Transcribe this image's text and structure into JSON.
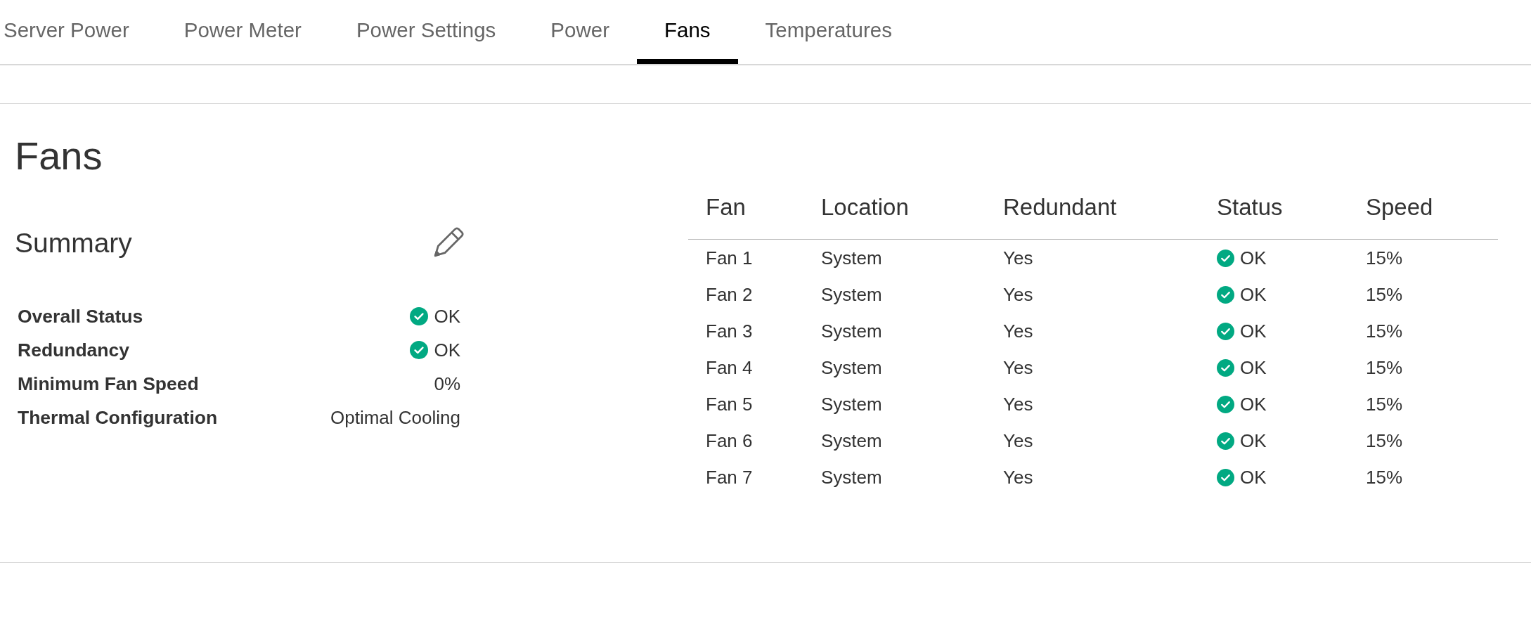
{
  "tabs": [
    {
      "label": "Server Power",
      "selected": false
    },
    {
      "label": "Power Meter",
      "selected": false
    },
    {
      "label": "Power Settings",
      "selected": false
    },
    {
      "label": "Power",
      "selected": false
    },
    {
      "label": "Fans",
      "selected": true
    },
    {
      "label": "Temperatures",
      "selected": false
    }
  ],
  "page_title": "Fans",
  "summary": {
    "title": "Summary",
    "rows": [
      {
        "kind": "status",
        "label": "Overall Status",
        "value": "OK",
        "healthy": true
      },
      {
        "kind": "status",
        "label": "Redundancy",
        "value": "OK",
        "healthy": true
      },
      {
        "kind": "text",
        "label": "Minimum Fan Speed",
        "value": "0%"
      },
      {
        "kind": "text",
        "label": "Thermal Configuration",
        "value": "Optimal Cooling"
      }
    ]
  },
  "fans_table": {
    "columns": [
      "Fan",
      "Location",
      "Redundant",
      "Status",
      "Speed"
    ],
    "rows": [
      {
        "fan": "Fan 1",
        "location": "System",
        "redundant": "Yes",
        "status": "OK",
        "healthy": true,
        "speed": "15%"
      },
      {
        "fan": "Fan 2",
        "location": "System",
        "redundant": "Yes",
        "status": "OK",
        "healthy": true,
        "speed": "15%"
      },
      {
        "fan": "Fan 3",
        "location": "System",
        "redundant": "Yes",
        "status": "OK",
        "healthy": true,
        "speed": "15%"
      },
      {
        "fan": "Fan 4",
        "location": "System",
        "redundant": "Yes",
        "status": "OK",
        "healthy": true,
        "speed": "15%"
      },
      {
        "fan": "Fan 5",
        "location": "System",
        "redundant": "Yes",
        "status": "OK",
        "healthy": true,
        "speed": "15%"
      },
      {
        "fan": "Fan 6",
        "location": "System",
        "redundant": "Yes",
        "status": "OK",
        "healthy": true,
        "speed": "15%"
      },
      {
        "fan": "Fan 7",
        "location": "System",
        "redundant": "Yes",
        "status": "OK",
        "healthy": true,
        "speed": "15%"
      }
    ]
  }
}
